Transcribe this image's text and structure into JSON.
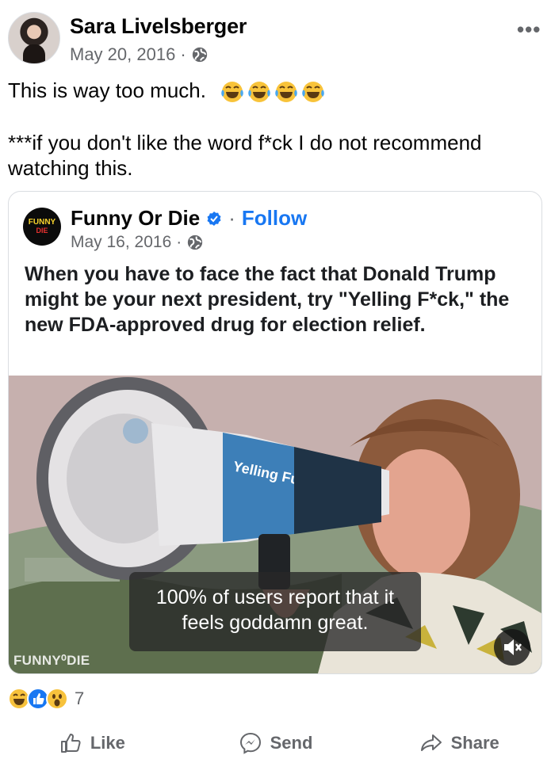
{
  "post": {
    "author": "Sara Livelsberger",
    "date": "May 20, 2016",
    "privacy_icon": "globe-icon",
    "more_label": "•••",
    "text_line1": "This is way too much.",
    "text_line2": "***if you don't like the word f*ck I do not recommend watching this.",
    "emoji_icon": "laughing-tears-emoji"
  },
  "shared": {
    "page_name": "Funny Or Die",
    "separator": "·",
    "follow_label": "Follow",
    "date": "May 16, 2016",
    "logo_top": "FUNNY",
    "logo_bottom": "DIE",
    "text": "When you have to face the fact that Donald Trump might be your next president, try \"Yelling F*ck,\" the new FDA-approved drug for election relief.",
    "video": {
      "caption": "100% of users report that it feels goddamn great.",
      "watermark": "FUNNY⁰DIE",
      "megaphone_label": "Yelling Fuck",
      "muted": true
    }
  },
  "reactions": {
    "count": "7",
    "types": [
      "haha",
      "like",
      "wow"
    ]
  },
  "actions": {
    "like": "Like",
    "send": "Send",
    "share": "Share"
  },
  "colors": {
    "accent": "#1877f2",
    "secondary_text": "#65676b",
    "border": "#dadde1"
  }
}
